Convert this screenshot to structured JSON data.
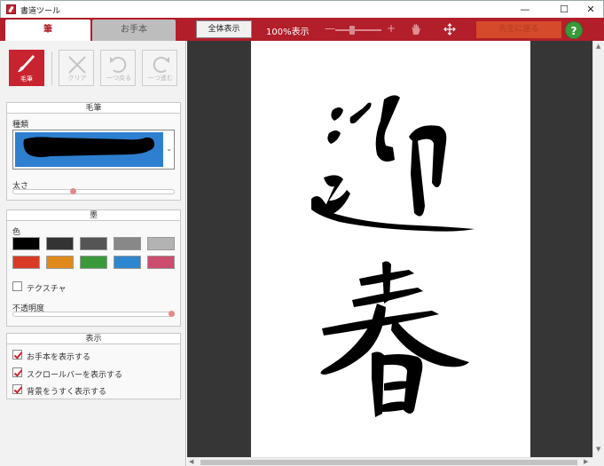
{
  "window": {
    "title": "書道ツール",
    "minimize": "—",
    "maximize": "☐",
    "close": "✕"
  },
  "tabs": [
    {
      "label": "筆",
      "active": true
    },
    {
      "label": "お手本",
      "active": false
    }
  ],
  "toolbar": {
    "fit_label": "全体表示",
    "zoom_text": "100%表示",
    "zoom_minus": "—",
    "zoom_plus": "+",
    "zoom_level": 0.35,
    "send_label": "先生に送る",
    "help_label": "?"
  },
  "tools": [
    {
      "label": "毛筆",
      "icon": "brush-icon",
      "active": true
    },
    {
      "label": "クリア",
      "icon": "clear-icon",
      "active": false
    },
    {
      "label": "一つ戻る",
      "icon": "undo-icon",
      "active": false
    },
    {
      "label": "一つ進む",
      "icon": "redo-icon",
      "active": false
    }
  ],
  "brush_section": {
    "title": "毛筆",
    "type_label": "種類",
    "size_label": "太さ",
    "size_value": 0.37
  },
  "ink_section": {
    "title": "墨",
    "color_label": "色",
    "colors": [
      "#000000",
      "#333333",
      "#555555",
      "#888888",
      "#b3b3b3",
      "#d93a26",
      "#e08a1e",
      "#3a9a3a",
      "#2e86cf",
      "#cc4d6e"
    ],
    "texture_label": "テクスチャ",
    "texture_checked": false,
    "opacity_label": "不透明度",
    "opacity_value": 1.0
  },
  "display_section": {
    "title": "表示",
    "options": [
      {
        "label": "お手本を表示する",
        "checked": true
      },
      {
        "label": "スクロールバーを表示する",
        "checked": true
      },
      {
        "label": "背景をうすく表示する",
        "checked": true
      }
    ]
  },
  "colors": {
    "accent": "#b21e2a",
    "canvas_bg": "#363636"
  }
}
